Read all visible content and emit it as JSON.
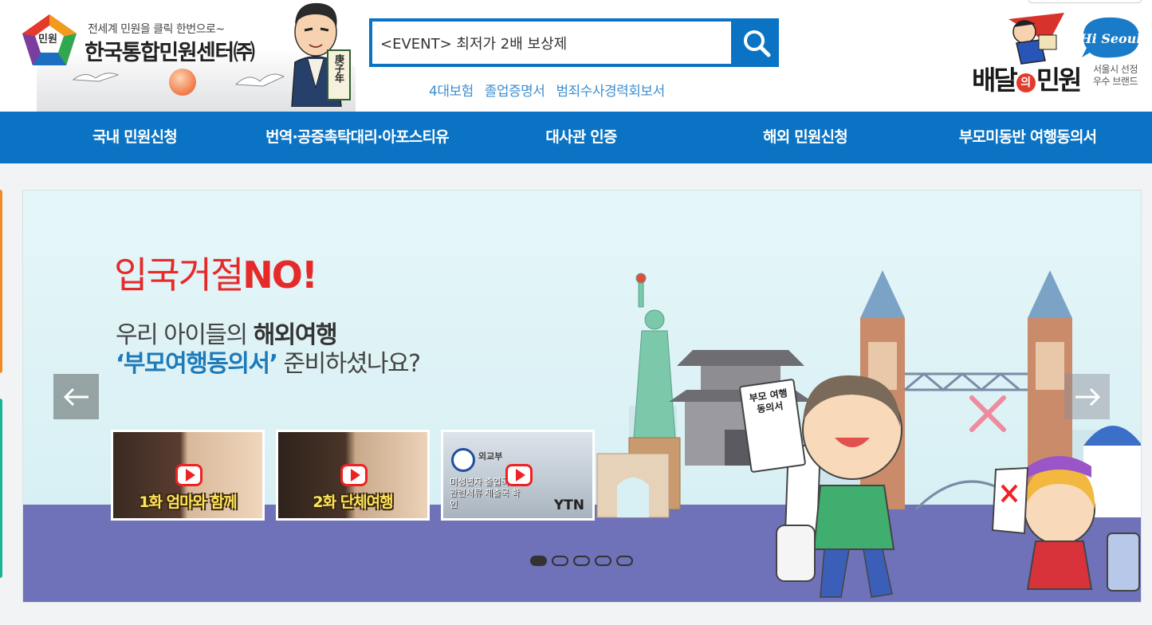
{
  "header": {
    "logo": {
      "emblem_text": "민원",
      "tagline": "전세계 민원을 클릭 한번으로~",
      "name": "한국통합민원센터㈜",
      "seal_text": "庚子年"
    },
    "search": {
      "value": "<EVENT> 최저가 2배 보상제",
      "button_icon": "search-icon"
    },
    "quick_links": [
      "4대보험",
      "졸업증명서",
      "범죄수사경력회보서"
    ],
    "brand": {
      "badge": "Hi Seoul",
      "title_pre": "배달",
      "title_mid": "의",
      "title_post": "민원",
      "sub_line1": "서울시 선정",
      "sub_line2": "우수 브랜드"
    }
  },
  "nav": {
    "items": [
      "국내 민원신청",
      "번역·공증촉탁대리·아포스티유",
      "대사관 인증",
      "해외 민원신청",
      "부모미동반 여행동의서"
    ]
  },
  "banner": {
    "headline_pre": "입국거절",
    "headline_bold": "NO!",
    "line2_pre": "우리 아이들의 ",
    "line2_bold": "해외여행",
    "line3_bold": "‘부모여행동의서’",
    "line3_post": " 준비하셨나요?",
    "document_text": "부모 여행 동의서",
    "thumbnails": [
      {
        "caption": "1화 엄마와 함께"
      },
      {
        "caption": "2화 단체여행"
      },
      {
        "caption": "미성년자 출입국시 관련서류 제출국 확인",
        "channel": "YTN",
        "tag": "외교부"
      }
    ],
    "slide_count": 5,
    "active_slide": 1,
    "colors": {
      "headline": "#e52a2a",
      "accent": "#1e7ab8",
      "ground": "#6f72b8",
      "sky": "#e3f5f7",
      "nav": "#0a73c4"
    }
  }
}
